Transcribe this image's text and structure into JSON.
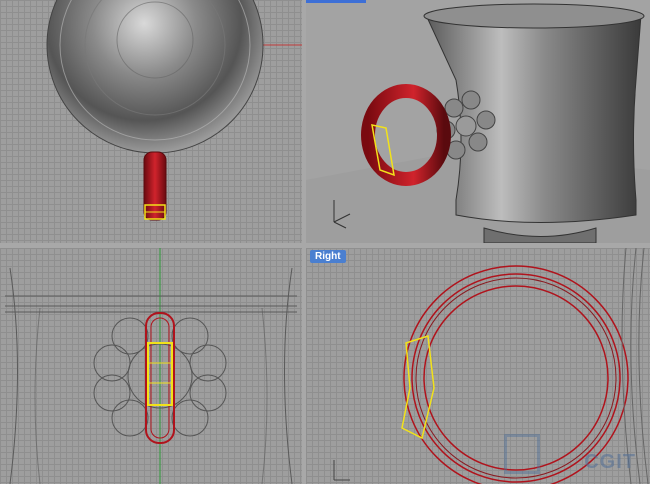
{
  "viewports": {
    "top": {
      "label": ""
    },
    "perspective": {
      "label": ""
    },
    "front": {
      "label": ""
    },
    "right": {
      "label": "Right"
    }
  },
  "watermark": {
    "text": "CGIT"
  },
  "colors": {
    "handle_red": "#b0131c",
    "selection_yellow": "#f2e21a",
    "axis_green": "#2f9a3a",
    "axis_red": "#c23a3a",
    "active_tab": "#3d6fd6"
  }
}
